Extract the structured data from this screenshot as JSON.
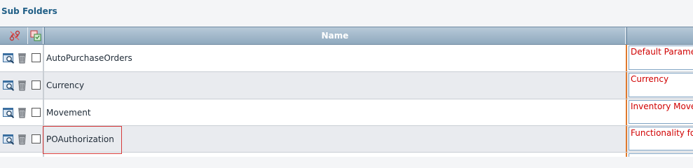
{
  "section": {
    "title": "Sub Folders"
  },
  "table": {
    "columns": {
      "name": "Name"
    },
    "rows": [
      {
        "name": "AutoPurchaseOrders",
        "description": "Default Parameters"
      },
      {
        "name": "Currency",
        "description": "Currency"
      },
      {
        "name": "Movement",
        "description": "Inventory Movement"
      },
      {
        "name": "POAuthorization",
        "description": "Functionality for"
      }
    ]
  },
  "icons": {
    "header_action": "link-break-icon",
    "header_select": "multi-select-icon",
    "row_view": "magnifier-view-icon",
    "row_delete": "trash-icon"
  },
  "colors": {
    "title": "#1f5e86",
    "header_bg": "#9fb6c9",
    "description_text": "#d00000",
    "description_divider": "#e07a2e",
    "highlight": "#d63a3a"
  }
}
